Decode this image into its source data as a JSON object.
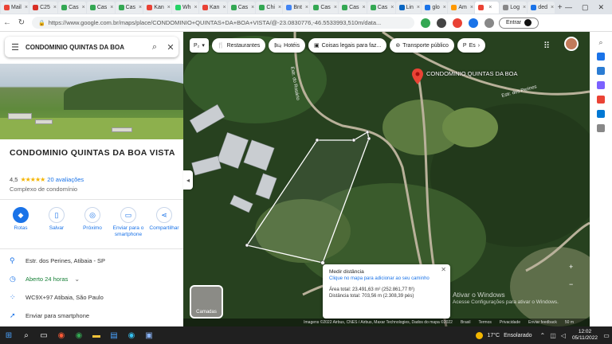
{
  "browser": {
    "tabs": [
      {
        "label": "Mail",
        "color": "#ea4335"
      },
      {
        "label": "C25",
        "color": "#d93025"
      },
      {
        "label": "Cas",
        "color": "#34a853"
      },
      {
        "label": "Cas",
        "color": "#34a853"
      },
      {
        "label": "Cas",
        "color": "#34a853"
      },
      {
        "label": "Kan",
        "color": "#e94235"
      },
      {
        "label": "Wh",
        "color": "#25d366"
      },
      {
        "label": "Kan",
        "color": "#e94235"
      },
      {
        "label": "Cas",
        "color": "#34a853"
      },
      {
        "label": "Chi",
        "color": "#34a853"
      },
      {
        "label": "Bnt",
        "color": "#4285f4"
      },
      {
        "label": "Cas",
        "color": "#34a853"
      },
      {
        "label": "Cas",
        "color": "#34a853"
      },
      {
        "label": "Cas",
        "color": "#34a853"
      },
      {
        "label": "Lin",
        "color": "#0a66c2"
      },
      {
        "label": "glo",
        "color": "#1a73e8"
      },
      {
        "label": "Am",
        "color": "#ff9900"
      },
      {
        "label": "",
        "color": "#ea4335",
        "active": true
      },
      {
        "label": "Log",
        "color": "#888888"
      },
      {
        "label": "ded",
        "color": "#1a73e8"
      }
    ],
    "url": "https://www.google.com.br/maps/place/CONDOMINIO+QUINTAS+DA+BOA+VISTA/@-23.0830776,-46.5533993,510m/data...",
    "signin_label": "Entrar"
  },
  "panel": {
    "search_value": "CONDOMINIO QUINTAS DA BOA",
    "title": "CONDOMINIO QUINTAS DA BOA VISTA",
    "rating": "4,5",
    "stars": "★★★★★",
    "reviews": "20 avaliações",
    "category": "Complexo de condomínio",
    "actions": [
      {
        "label": "Rotas",
        "icon": "directions-icon"
      },
      {
        "label": "Salvar",
        "icon": "bookmark-icon"
      },
      {
        "label": "Próximo",
        "icon": "nearby-icon"
      },
      {
        "label": "Enviar para o smartphone",
        "icon": "phone-icon"
      },
      {
        "label": "Compartilhar",
        "icon": "share-icon"
      }
    ],
    "address": "Estr. dos Perines, Atibaia - SP",
    "hours_status": "Aberto 24 horas",
    "plus_code": "WC9X+97 Atibaia, São Paulo",
    "send_phone": "Enviar para smartphone"
  },
  "map": {
    "chips": [
      "Restaurantes",
      "Hotéis",
      "Coisas legais para faz...",
      "Transporte público",
      "Es"
    ],
    "pin_label": "CONDOMINIO QUINTAS DA BOA",
    "road_labels": [
      "Estr. do Rosário",
      "Estr. dos Perines"
    ],
    "layers_label": "Camadas",
    "measure": {
      "heading": "Medir distância",
      "hint": "Clique no mapa para adicionar ao seu caminho",
      "area": "Área total: 23.491,63 m² (252.861,77 ft²)",
      "distance": "Distância total: 703,56 m (2.308,39 pés)"
    },
    "attribution": [
      "Imagens ©2022 Airbus, CNES / Airbus, Maxar Technologies, Dados do mapa ©2022",
      "Brasil",
      "Termos",
      "Privacidade",
      "Enviar feedback",
      "50 m"
    ],
    "watermark_title": "Ativar o Windows",
    "watermark_sub": "Acesse Configurações para ativar o Windows."
  },
  "taskbar": {
    "weather_temp": "17°C",
    "weather_desc": "Ensolarado",
    "time": "12:02",
    "date": "05/11/2022"
  }
}
